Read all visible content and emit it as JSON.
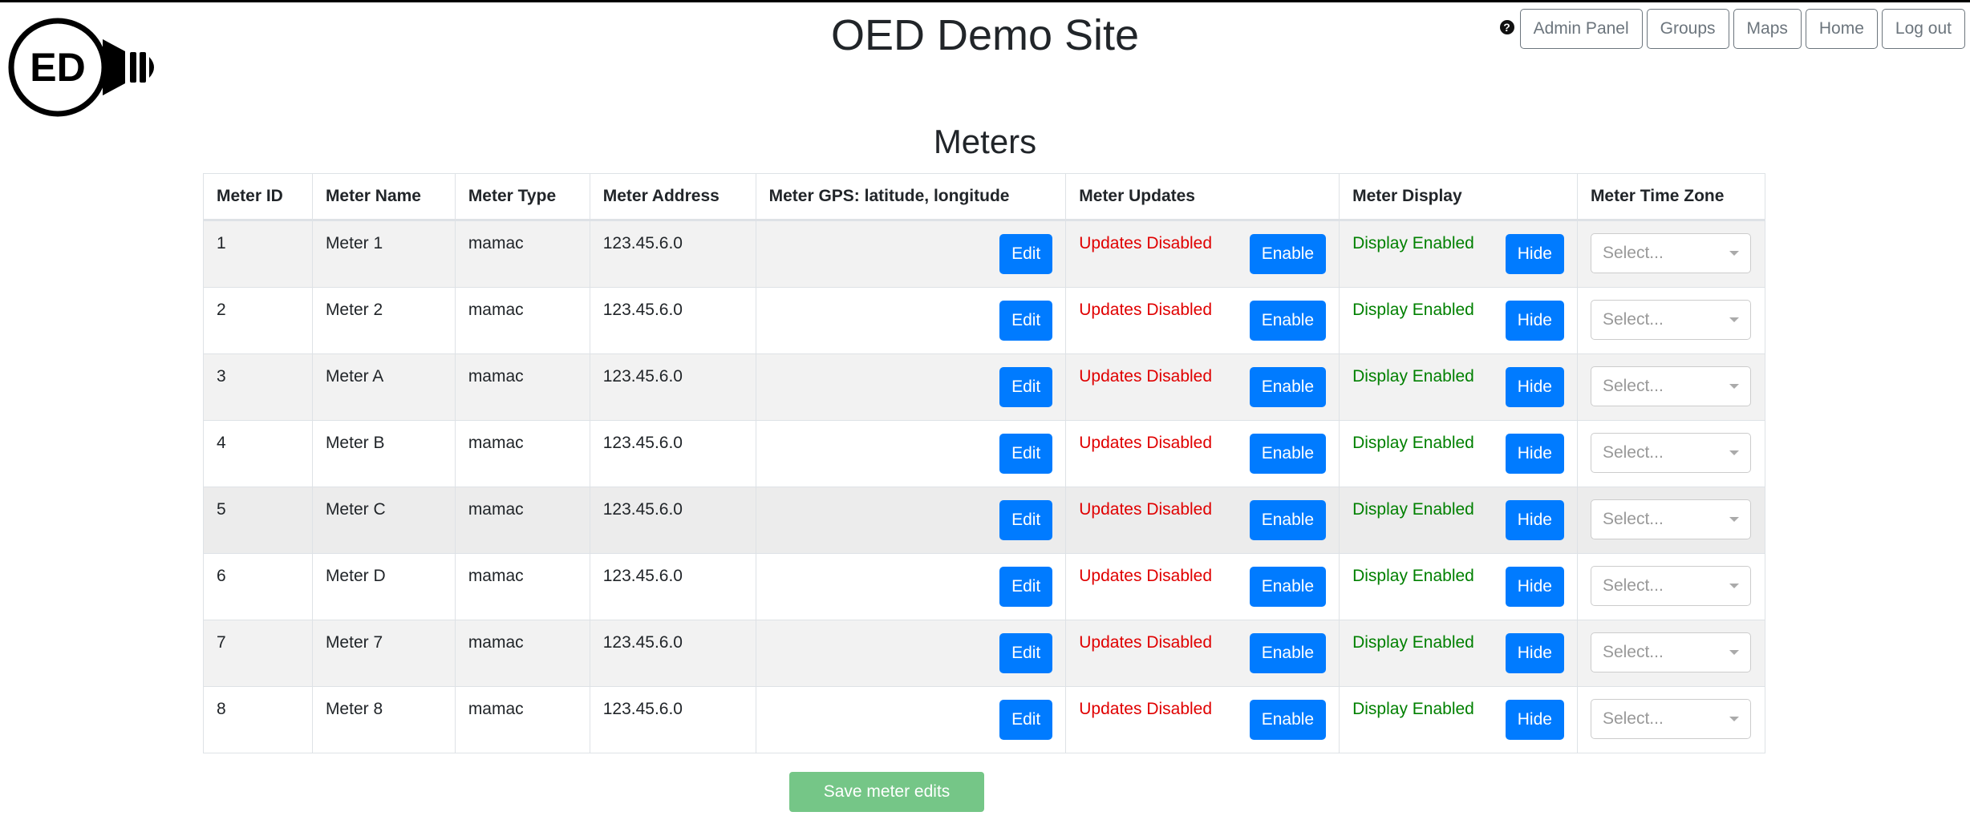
{
  "header": {
    "logo_alt": "OED",
    "logo_text": "ED",
    "title": "OED Demo Site",
    "help_icon": "question-circle-icon",
    "nav": [
      {
        "label": "Admin Panel"
      },
      {
        "label": "Groups"
      },
      {
        "label": "Maps"
      },
      {
        "label": "Home"
      },
      {
        "label": "Log out"
      }
    ]
  },
  "page": {
    "heading": "Meters"
  },
  "table": {
    "columns": [
      "Meter ID",
      "Meter Name",
      "Meter Type",
      "Meter Address",
      "Meter GPS: latitude, longitude",
      "Meter Updates",
      "Meter Display",
      "Meter Time Zone"
    ],
    "rows": [
      {
        "id": "1",
        "name": "Meter 1",
        "type": "mamac",
        "address": "123.45.6.0",
        "gps": "",
        "edit_label": "Edit",
        "updates_status": "Updates Disabled",
        "updates_button": "Enable",
        "display_status": "Display Enabled",
        "display_button": "Hide",
        "timezone_placeholder": "Select..."
      },
      {
        "id": "2",
        "name": "Meter 2",
        "type": "mamac",
        "address": "123.45.6.0",
        "gps": "",
        "edit_label": "Edit",
        "updates_status": "Updates Disabled",
        "updates_button": "Enable",
        "display_status": "Display Enabled",
        "display_button": "Hide",
        "timezone_placeholder": "Select..."
      },
      {
        "id": "3",
        "name": "Meter A",
        "type": "mamac",
        "address": "123.45.6.0",
        "gps": "",
        "edit_label": "Edit",
        "updates_status": "Updates Disabled",
        "updates_button": "Enable",
        "display_status": "Display Enabled",
        "display_button": "Hide",
        "timezone_placeholder": "Select..."
      },
      {
        "id": "4",
        "name": "Meter B",
        "type": "mamac",
        "address": "123.45.6.0",
        "gps": "",
        "edit_label": "Edit",
        "updates_status": "Updates Disabled",
        "updates_button": "Enable",
        "display_status": "Display Enabled",
        "display_button": "Hide",
        "timezone_placeholder": "Select..."
      },
      {
        "id": "5",
        "name": "Meter C",
        "type": "mamac",
        "address": "123.45.6.0",
        "gps": "",
        "edit_label": "Edit",
        "updates_status": "Updates Disabled",
        "updates_button": "Enable",
        "display_status": "Display Enabled",
        "display_button": "Hide",
        "timezone_placeholder": "Select..."
      },
      {
        "id": "6",
        "name": "Meter D",
        "type": "mamac",
        "address": "123.45.6.0",
        "gps": "",
        "edit_label": "Edit",
        "updates_status": "Updates Disabled",
        "updates_button": "Enable",
        "display_status": "Display Enabled",
        "display_button": "Hide",
        "timezone_placeholder": "Select..."
      },
      {
        "id": "7",
        "name": "Meter 7",
        "type": "mamac",
        "address": "123.45.6.0",
        "gps": "",
        "edit_label": "Edit",
        "updates_status": "Updates Disabled",
        "updates_button": "Enable",
        "display_status": "Display Enabled",
        "display_button": "Hide",
        "timezone_placeholder": "Select..."
      },
      {
        "id": "8",
        "name": "Meter 8",
        "type": "mamac",
        "address": "123.45.6.0",
        "gps": "",
        "edit_label": "Edit",
        "updates_status": "Updates Disabled",
        "updates_button": "Enable",
        "display_status": "Display Enabled",
        "display_button": "Hide",
        "timezone_placeholder": "Select..."
      }
    ]
  },
  "footer": {
    "save_label": "Save meter edits"
  },
  "colors": {
    "primary": "#007bff",
    "disabled_status": "#e00000",
    "enabled_status": "#008000",
    "save_button": "#75c687"
  }
}
